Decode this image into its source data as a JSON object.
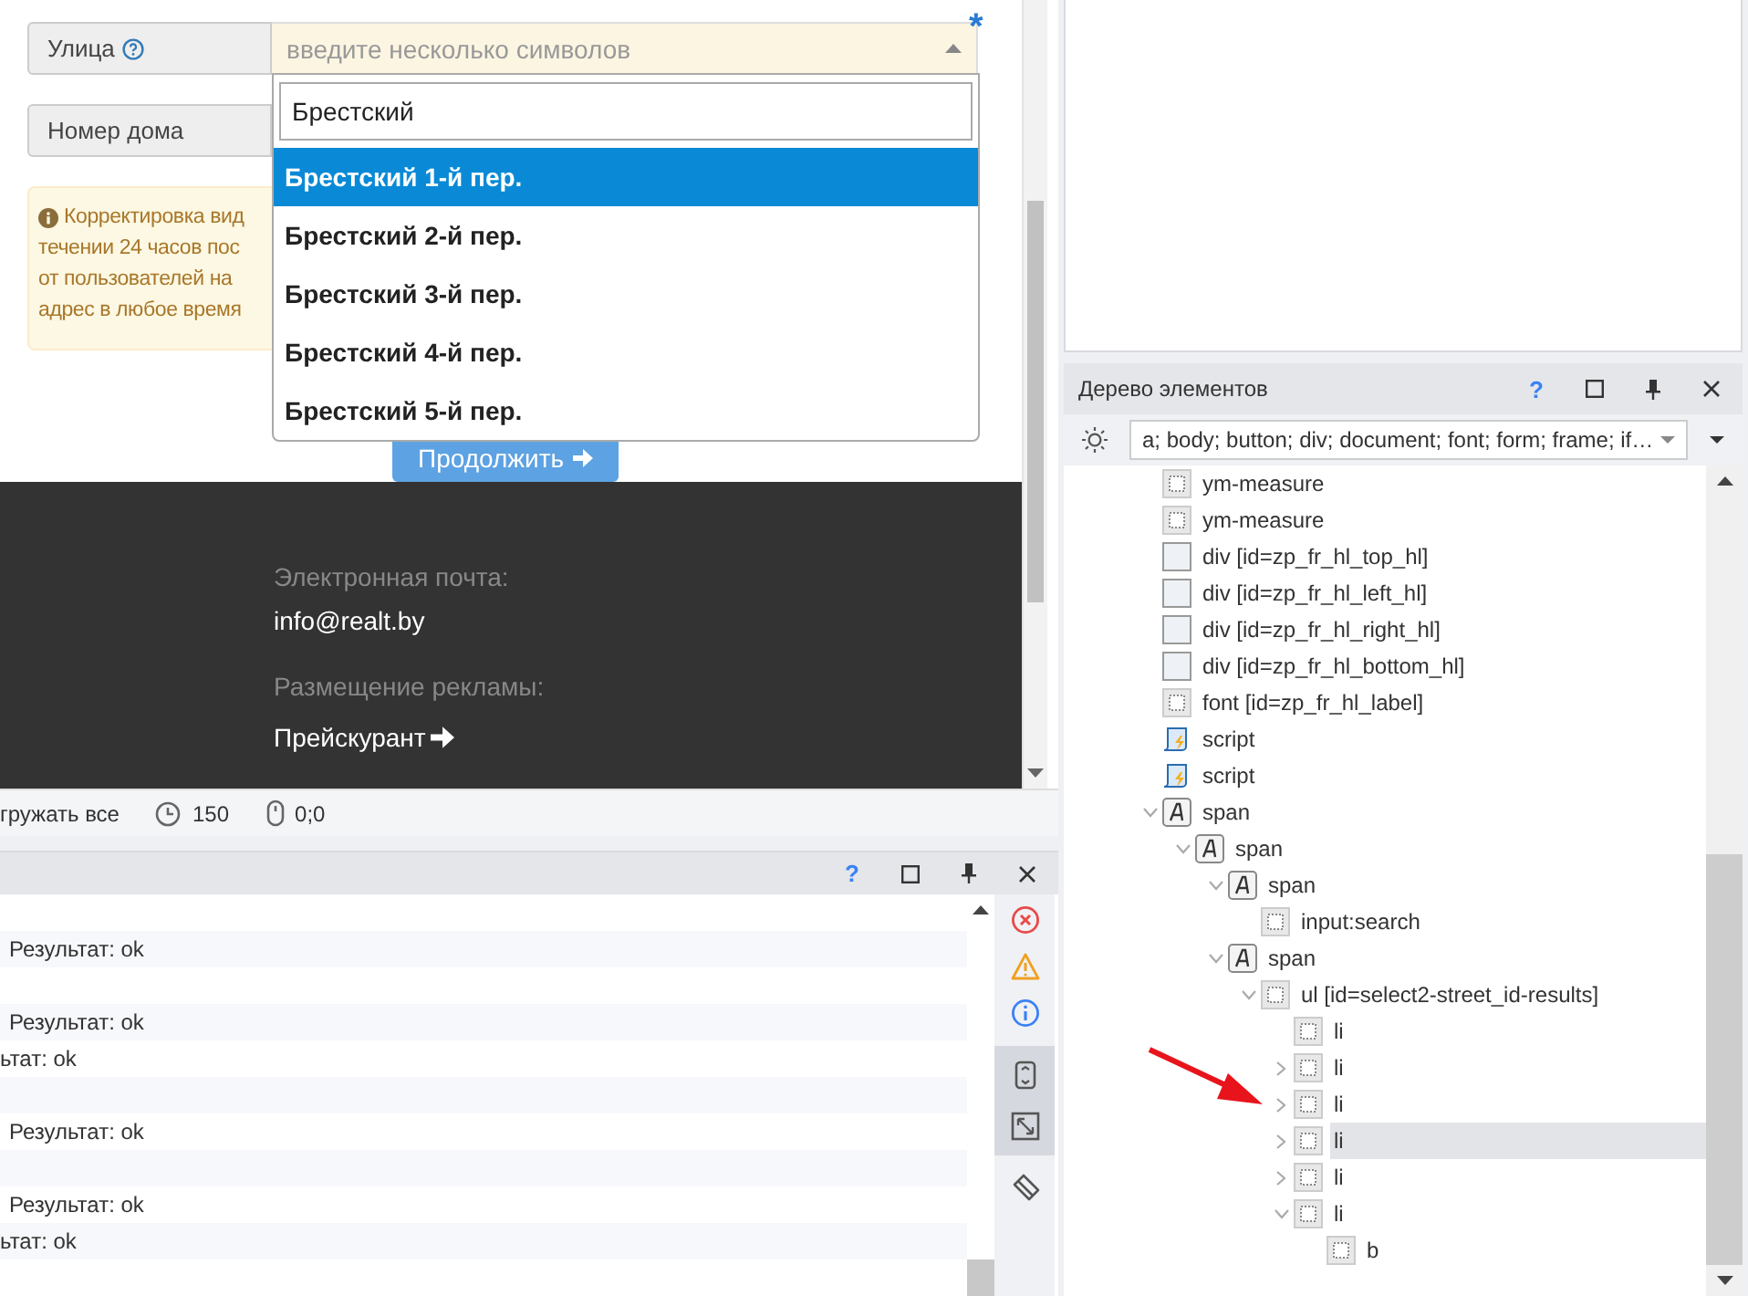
{
  "form": {
    "street_label": "Улица",
    "street_placeholder": "введите несколько символов",
    "required_mark": "*",
    "house_label": "Номер дома",
    "notice_lines": [
      "Корректировка вид",
      "течении 24 часов пос",
      "от пользователей на",
      "адрес в любое время"
    ],
    "continue_button": "Продолжить"
  },
  "dropdown": {
    "search_value": "Брестский",
    "options": [
      {
        "label": "Брестский 1-й пер.",
        "selected": true
      },
      {
        "label": "Брестский 2-й пер.",
        "selected": false
      },
      {
        "label": "Брестский 3-й пер.",
        "selected": false
      },
      {
        "label": "Брестский 4-й пер.",
        "selected": false
      },
      {
        "label": "Брестский 5-й пер.",
        "selected": false
      }
    ]
  },
  "footer": {
    "email_label": "Электронная почта:",
    "email": "info@realt.by",
    "ads_label": "Размещение рекламы:",
    "price_link": "Прейскурант"
  },
  "status_bar": {
    "load_all": "гружать все",
    "timeout": "150",
    "mouse": "0;0"
  },
  "log_panel": {
    "help_mark": "?",
    "rows": [
      {
        "kind": "empty"
      },
      {
        "kind": "result",
        "text": "Результат: ok"
      },
      {
        "kind": "empty"
      },
      {
        "kind": "result",
        "text": "Результат: ok"
      },
      {
        "kind": "cut",
        "text": "ьтат: ok"
      },
      {
        "kind": "empty"
      },
      {
        "kind": "result",
        "text": "Результат: ok"
      },
      {
        "kind": "empty"
      },
      {
        "kind": "result",
        "text": "Результат: ok"
      },
      {
        "kind": "cut",
        "text": "ьтат: ok"
      },
      {
        "kind": "empty"
      }
    ]
  },
  "tree_panel": {
    "title": "Дерево элементов",
    "help_mark": "?",
    "filter": "a; body; button; div; document; font; form; frame; if…",
    "items": [
      {
        "label": "ym-measure",
        "kind": "dotted",
        "selected": false
      },
      {
        "label": "ym-measure",
        "kind": "dotted",
        "selected": false
      },
      {
        "label": "div [id=zp_fr_hl_top_hl]",
        "kind": "box",
        "selected": false
      },
      {
        "label": "div [id=zp_fr_hl_left_hl]",
        "kind": "box",
        "selected": false
      },
      {
        "label": "div [id=zp_fr_hl_right_hl]",
        "kind": "box",
        "selected": false
      },
      {
        "label": "div [id=zp_fr_hl_bottom_hl]",
        "kind": "box",
        "selected": false
      },
      {
        "label": "font [id=zp_fr_hl_label]",
        "kind": "dotted",
        "selected": false
      },
      {
        "label": "script",
        "kind": "script",
        "selected": false
      },
      {
        "label": "script",
        "kind": "script",
        "selected": false
      },
      {
        "label": "span",
        "kind": "text",
        "expanded": true,
        "selected": false,
        "children": [
          {
            "label": "span",
            "kind": "text",
            "expanded": true,
            "selected": false,
            "children": [
              {
                "label": "span",
                "kind": "text",
                "expanded": true,
                "selected": false,
                "children": [
                  {
                    "label": "input:search",
                    "kind": "dotted",
                    "selected": false
                  }
                ]
              },
              {
                "label": "span",
                "kind": "text",
                "expanded": true,
                "selected": false,
                "children": [
                  {
                    "label": "ul [id=select2-street_id-results]",
                    "kind": "dotted",
                    "expanded": true,
                    "selected": false,
                    "children": [
                      {
                        "label": "li",
                        "kind": "dotted",
                        "selected": false
                      },
                      {
                        "label": "li",
                        "kind": "dotted",
                        "expanded": false,
                        "selected": false
                      },
                      {
                        "label": "li",
                        "kind": "dotted",
                        "expanded": false,
                        "selected": false
                      },
                      {
                        "label": "li",
                        "kind": "dotted",
                        "expanded": false,
                        "selected": true
                      },
                      {
                        "label": "li",
                        "kind": "dotted",
                        "expanded": false,
                        "selected": false
                      },
                      {
                        "label": "li",
                        "kind": "dotted",
                        "expanded": true,
                        "selected": false,
                        "children": [
                          {
                            "label": "b",
                            "kind": "dotted",
                            "selected": false
                          }
                        ]
                      }
                    ]
                  }
                ]
              }
            ]
          }
        ]
      }
    ]
  }
}
